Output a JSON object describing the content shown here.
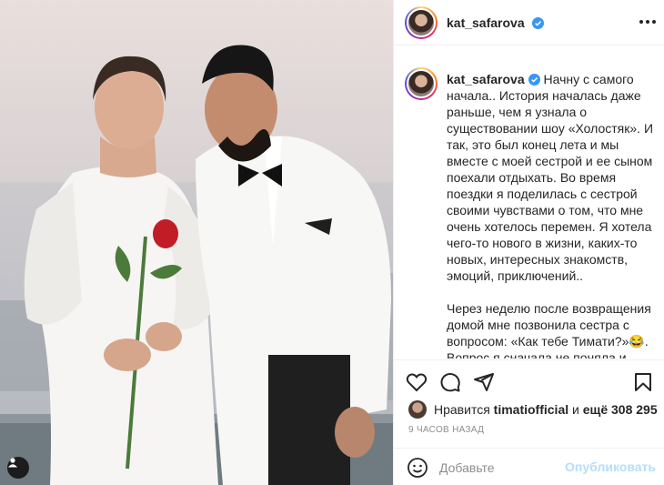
{
  "post": {
    "username": "kat_safarova",
    "caption_paragraph_1": "Начну с самого начала.. История началась даже раньше, чем я узнала о существовании шоу «Холостяк». И так, это был конец лета и мы вместе с моей сестрой и ее сыном поехали отдыхать. Во время поездки я поделилась с сестрой своими чувствами о том, что мне очень хотелось перемен. Я хотела чего-то нового в жизни, каких-то новых, интересных знакомств, эмоций, приключений..",
    "caption_paragraph_2": "Через неделю после возвращения домой мне позвонила сестра с вопросом: «Как тебе Тимати?»😂. Вопрос я сначала не поняла и просто рассмеялась со словами «поет",
    "likes_prefix": "Нравится",
    "likes_user": "timatiofficial",
    "likes_connector": "и",
    "likes_count": "ещё 308 295",
    "time": "9 ЧАСОВ НАЗАД"
  },
  "comment": {
    "placeholder": "Добавьте",
    "publish_label": "Опубликовать"
  },
  "icons": {
    "verified": "verified-badge-icon",
    "more": "more-options-icon",
    "like": "heart-icon",
    "comment": "comment-bubble-icon",
    "share": "paper-plane-icon",
    "save": "bookmark-icon",
    "emoji": "emoji-icon",
    "tag": "user-tag-icon"
  },
  "colors": {
    "accent": "#0095f6",
    "publish_disabled": "#b2dffc",
    "muted": "#8e8e8e"
  }
}
